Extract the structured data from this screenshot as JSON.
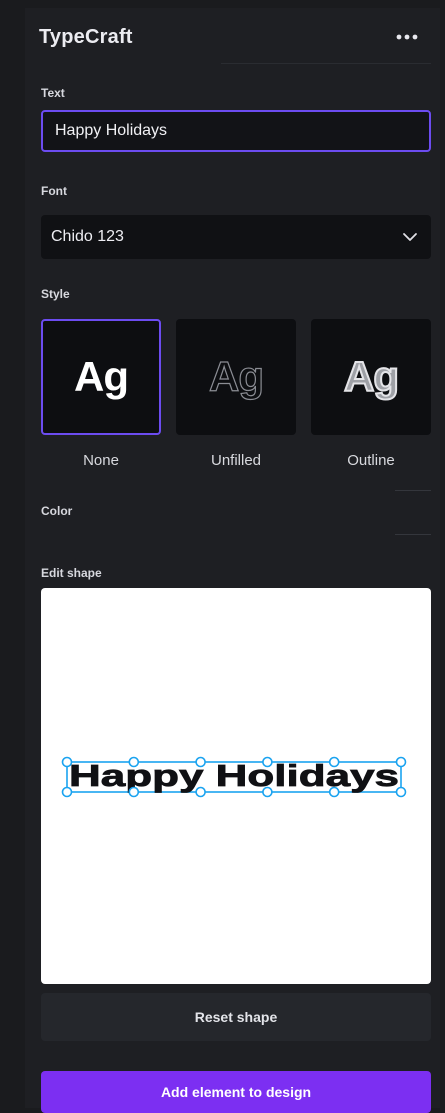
{
  "app": {
    "title": "TypeCraft",
    "more_icon": "more-horizontal-icon"
  },
  "text_section": {
    "label": "Text",
    "value": "Happy Holidays",
    "placeholder": ""
  },
  "font_section": {
    "label": "Font",
    "selected": "Chido 123",
    "chevron_icon": "chevron-down-icon"
  },
  "style_section": {
    "label": "Style",
    "selected": "None",
    "options": [
      {
        "preview": "Ag",
        "label": "None"
      },
      {
        "preview": "Ag",
        "label": "Unfilled"
      },
      {
        "preview": "Ag",
        "label": "Outline"
      }
    ]
  },
  "color_section": {
    "label": "Color"
  },
  "shape_section": {
    "label": "Edit shape",
    "preview_text": "Happy Holidays",
    "handle_count": 12
  },
  "buttons": {
    "reset": "Reset shape",
    "add": "Add element to design"
  },
  "colors": {
    "panel_bg": "#1e1f23",
    "accent_purple": "#6c4cf0",
    "primary_button": "#7c2ff2",
    "selection_blue": "#1aa3f0",
    "preview_text": "#101114"
  }
}
